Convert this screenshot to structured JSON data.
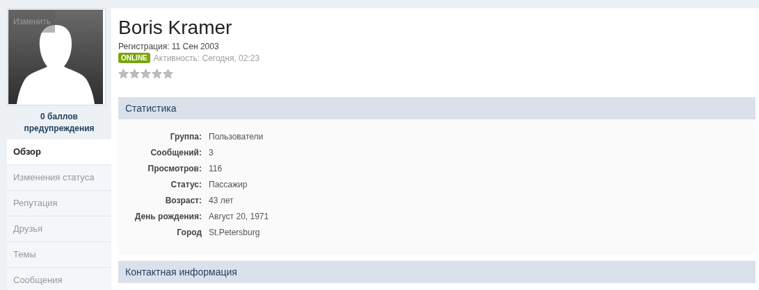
{
  "profile": {
    "name": "Boris Kramer",
    "registration": "Регистрация: 11 Сен 2003",
    "status_badge": "ONLINE",
    "online": true,
    "activity": "Активность: Сегодня, 02:23",
    "stars": 0
  },
  "avatar": {
    "edit_button": "Изменить"
  },
  "warnings": "0 баллов предупреждения",
  "nav": [
    {
      "label": "Обзор",
      "selected": true
    },
    {
      "label": "Изменения статуса",
      "selected": false
    },
    {
      "label": "Репутация",
      "selected": false
    },
    {
      "label": "Друзья",
      "selected": false
    },
    {
      "label": "Темы",
      "selected": false
    },
    {
      "label": "Сообщения",
      "selected": false
    }
  ],
  "sections": [
    {
      "title": "Статистика",
      "rows": [
        {
          "label": "Группа:",
          "value": "Пользователи"
        },
        {
          "label": "Сообщений:",
          "value": "3"
        },
        {
          "label": "Просмотров:",
          "value": "116"
        },
        {
          "label": "Статус:",
          "value": "Пассажир"
        },
        {
          "label": "Возраст:",
          "value": "43 лет"
        },
        {
          "label": "День рождения:",
          "value": "Август 20, 1971"
        },
        {
          "label": "Город",
          "value": "St.Petersburg"
        }
      ]
    },
    {
      "title": "Контактная информация"
    }
  ]
}
